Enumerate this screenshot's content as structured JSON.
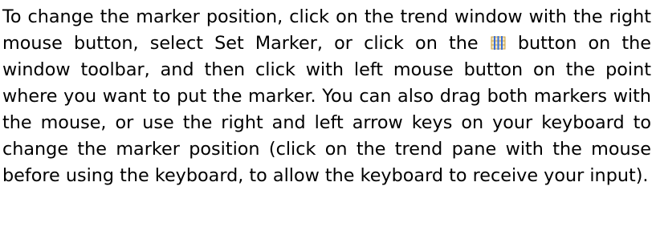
{
  "text": {
    "part1": "To change the marker position, click on the trend window with the right mouse button, select Set Marker, or click on the ",
    "part2": " button on the window toolbar, and then click with left mouse button on the point where you want to put the marker. You can also drag both markers with the mouse, or use the right and left arrow keys on your keyboard to change the marker position (click on the trend pane with the mouse before using the keyboard, to allow the keyboard to receive your input)."
  },
  "icons": {
    "inline_button": "set-marker-icon"
  },
  "colors": {
    "text": "#000000",
    "background": "#ffffff",
    "icon_marker": "#3a6fd8",
    "icon_grid": "#c8a040"
  }
}
